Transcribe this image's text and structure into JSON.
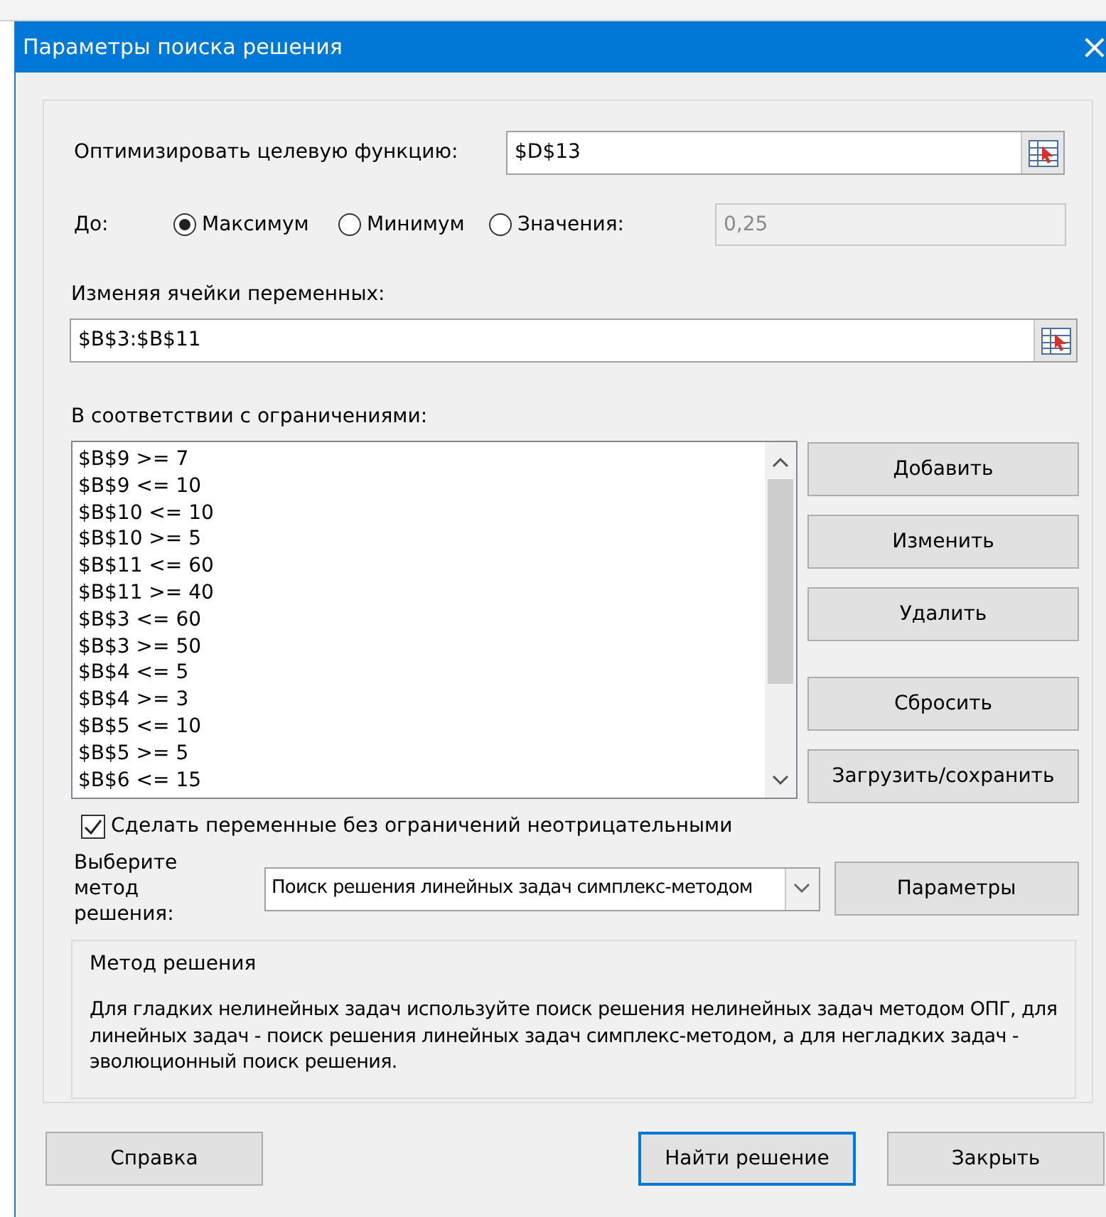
{
  "window": {
    "title": "Параметры поиска решения",
    "close": "×"
  },
  "objective": {
    "label": "Оптимизировать целевую функцию:",
    "value": "$D$13"
  },
  "to": {
    "label": "До:",
    "options": [
      {
        "label": "Максимум",
        "selected": true
      },
      {
        "label": "Минимум",
        "selected": false
      },
      {
        "label": "Значения:",
        "selected": false
      }
    ],
    "value_field": {
      "value": "0,25",
      "disabled": true
    }
  },
  "variables": {
    "label": "Изменяя ячейки переменных:",
    "value": "$B$3:$B$11"
  },
  "constraints": {
    "label": "В соответствии с ограничениями:",
    "items": [
      "$B$9 >= 7",
      "$B$9 <= 10",
      "$B$10 <= 10",
      "$B$10 >= 5",
      "$B$11 <= 60",
      "$B$11 >= 40",
      "$B$3 <= 60",
      "$B$3 >= 50",
      "$B$4 <= 5",
      "$B$4 >= 3",
      "$B$5 <= 10",
      "$B$5 >= 5",
      "$B$6 <= 15"
    ],
    "buttons": [
      "Добавить",
      "Изменить",
      "Удалить",
      "Сбросить",
      "Загрузить/сохранить"
    ]
  },
  "nonnegative": {
    "label": "Сделать переменные без ограничений неотрицательными",
    "checked": true
  },
  "method": {
    "label": "Выберите метод решения:",
    "value": "Поиск решения линейных задач симплекс-методом",
    "button": "Параметры"
  },
  "method_info": {
    "title": "Метод решения",
    "text": "Для гладких нелинейных задач используйте поиск решения нелинейных задач методом ОПГ, для линейных задач - поиск решения линейных задач симплекс-методом, а для негладких задач - эволюционный поиск решения."
  },
  "footer": [
    {
      "label": "Справка",
      "default": false
    },
    {
      "label": "Найти решение",
      "default": true
    },
    {
      "label": "Закрыть",
      "default": false
    }
  ]
}
